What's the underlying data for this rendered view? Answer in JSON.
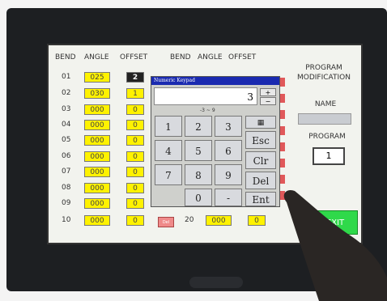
{
  "headers": {
    "bend": "BEND",
    "angle": "ANGLE",
    "offset": "OFFSET",
    "bend2": "BEND",
    "angle2": "ANGLE",
    "offset2": "OFFSET"
  },
  "rows": [
    {
      "num": "01",
      "angle": "025",
      "offset": "2"
    },
    {
      "num": "02",
      "angle": "030",
      "offset": "1"
    },
    {
      "num": "03",
      "angle": "000",
      "offset": "0"
    },
    {
      "num": "04",
      "angle": "000",
      "offset": "0"
    },
    {
      "num": "05",
      "angle": "000",
      "offset": "0"
    },
    {
      "num": "06",
      "angle": "000",
      "offset": "0"
    },
    {
      "num": "07",
      "angle": "000",
      "offset": "0"
    },
    {
      "num": "08",
      "angle": "000",
      "offset": "0"
    },
    {
      "num": "09",
      "angle": "000",
      "offset": "0"
    },
    {
      "num": "10",
      "angle": "000",
      "offset": "0"
    }
  ],
  "right_row": {
    "num": "20",
    "angle": "000",
    "offset": "0"
  },
  "del_label": "Del",
  "keypad": {
    "title": "Numeric Keypad",
    "display": "3",
    "range": "-3 ~ 9",
    "plus": "+",
    "minus": "−",
    "keys": [
      "1",
      "2",
      "3",
      "4",
      "5",
      "6",
      "7",
      "8",
      "9",
      "0",
      "-"
    ],
    "esc": "Esc",
    "clr": "Clr",
    "del": "Del",
    "enter": "Ent"
  },
  "program_panel": {
    "title": "PROGRAM MODIFICATION",
    "name_label": "NAME",
    "name_value": "",
    "program_label": "PROGRAM",
    "program_value": "1",
    "exit": "EXIT"
  },
  "colors": {
    "cell_yellow": "#fff200",
    "exit_green": "#2fd94a",
    "keypad_title": "#1a2ab0",
    "del_red": "#ef8a8a"
  }
}
